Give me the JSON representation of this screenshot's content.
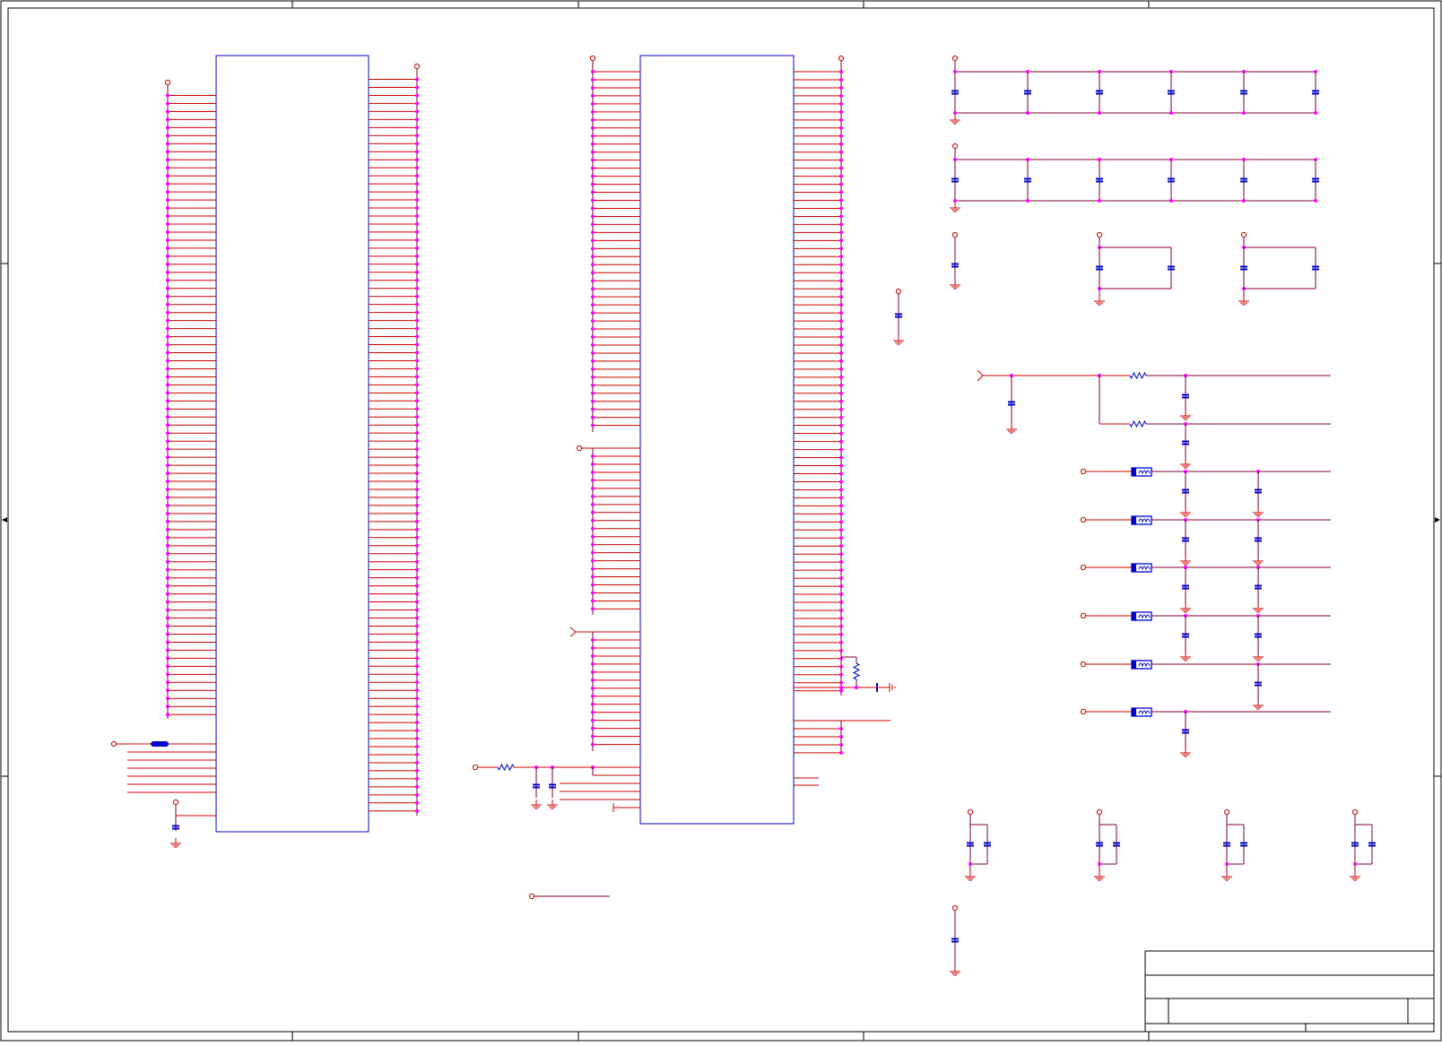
{
  "sheet": {
    "frame_color": "#000000",
    "wire_color": "#cc0000",
    "net_color": "#7a0030",
    "junction_color": "#ff00ff",
    "part_color": "#0000cc",
    "power_color": "#cc0000"
  },
  "title_block": {
    "title": "",
    "document_number": "",
    "revision": "",
    "sheet": "",
    "date": ""
  }
}
